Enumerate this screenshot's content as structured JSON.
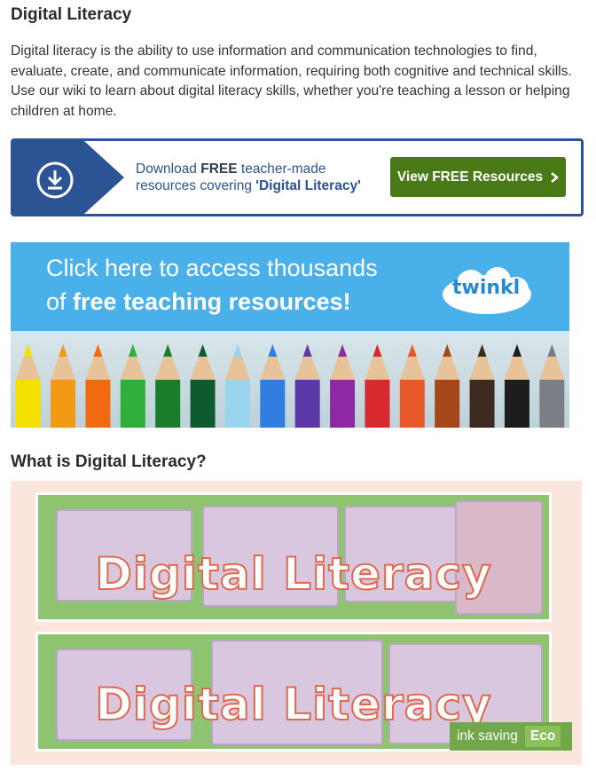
{
  "title": "Digital Literacy",
  "intro": "Digital literacy is the ability to use information and communication technologies to find, evaluate, create, and communicate information, requiring both cognitive and technical skills. Use our wiki to learn about digital literacy skills, whether you're teaching a lesson or helping children at home.",
  "cta": {
    "text_before": "Download ",
    "text_free": "FREE",
    "text_after": " teacher-made resources covering ",
    "topic": "'Digital Literacy'",
    "button": "View FREE Resources",
    "icon": "download-icon",
    "colors": {
      "border": "#2c5393",
      "button": "#4a7a17"
    }
  },
  "ad": {
    "line1": "Click here to access thousands",
    "line2_prefix": "of ",
    "line2_bold": "free teaching resources!",
    "logo": "twinkl"
  },
  "section_heading": "What is Digital Literacy?",
  "image": {
    "banner_text_1": "Digital Literacy",
    "banner_text_2": "Digital Literacy",
    "eco_label": "ink saving",
    "eco_badge": "Eco"
  }
}
